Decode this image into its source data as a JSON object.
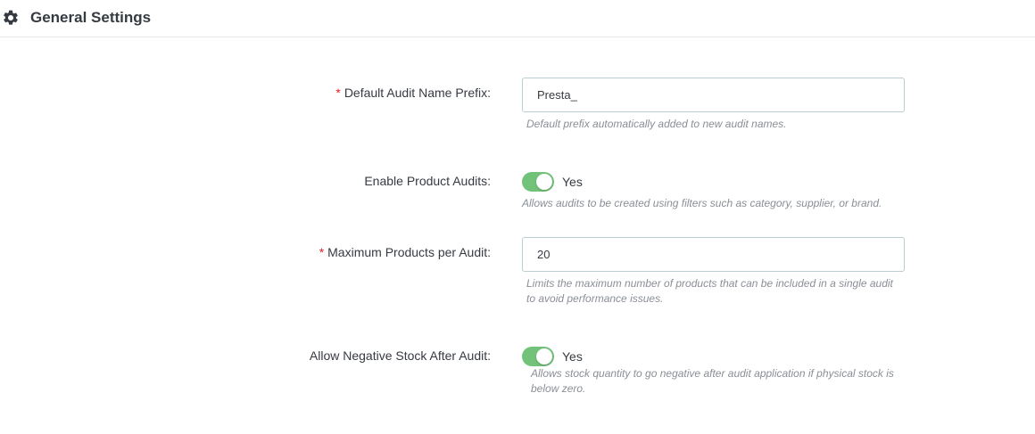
{
  "header": {
    "icon": "gear-icon",
    "title": "General Settings"
  },
  "fields": {
    "prefix": {
      "required_mark": "*",
      "label": "Default Audit Name Prefix:",
      "value": "Presta_",
      "help": "Default prefix automatically added to new audit names."
    },
    "enable_product_audits": {
      "label": "Enable Product Audits:",
      "state": "on",
      "state_label": "Yes",
      "help": "Allows audits to be created using filters such as category, supplier, or brand."
    },
    "max_products": {
      "required_mark": "*",
      "label": "Maximum Products per Audit:",
      "value": "20",
      "help_line1": "Limits the maximum number of products that can be included in a single audit",
      "help_line2": "to avoid performance issues."
    },
    "allow_negative_stock": {
      "label": "Allow Negative Stock After Audit:",
      "state": "on",
      "state_label": "Yes",
      "help_line1": "Allows stock quantity to go negative after audit application if physical stock is",
      "help_line2": "below zero."
    }
  },
  "colors": {
    "switch_on": "#72c279",
    "required": "#e61e27",
    "help_text": "#8a8f96",
    "input_border": "#bbcdd2"
  }
}
